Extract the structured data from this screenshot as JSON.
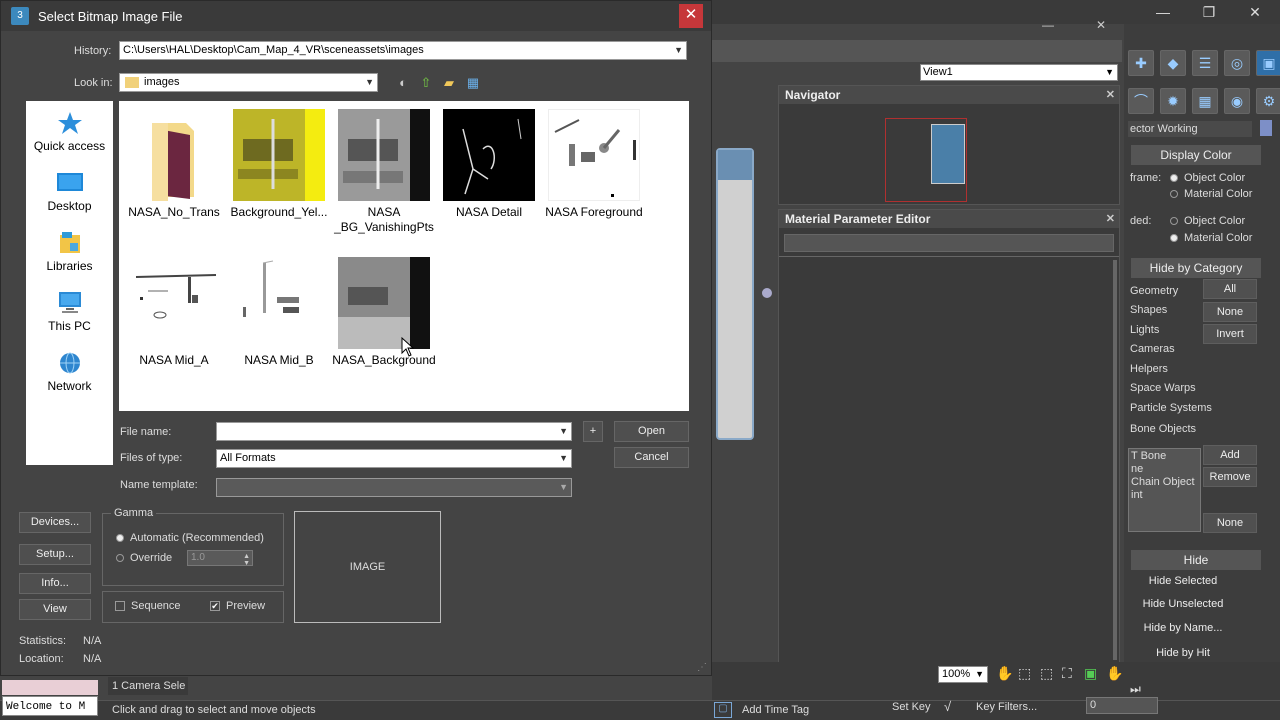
{
  "dialog": {
    "title": "Select Bitmap Image File",
    "close_glyph": "✕",
    "history_label": "History:",
    "history_value": "C:\\Users\\HAL\\Desktop\\Cam_Map_4_VR\\sceneassets\\images",
    "lookin_label": "Look in:",
    "lookin_value": "images",
    "places": [
      {
        "label": "Quick access",
        "icon": "star-icon"
      },
      {
        "label": "Desktop",
        "icon": "desktop-icon"
      },
      {
        "label": "Libraries",
        "icon": "libraries-icon"
      },
      {
        "label": "This PC",
        "icon": "computer-icon"
      },
      {
        "label": "Network",
        "icon": "network-icon"
      }
    ],
    "files": [
      {
        "label": "NASA_No_Trans"
      },
      {
        "label": "Background_Yel..."
      },
      {
        "label": "NASA _BG_VanishingPts"
      },
      {
        "label": "NASA Detail"
      },
      {
        "label": "NASA Foreground"
      },
      {
        "label": "NASA Mid_A"
      },
      {
        "label": "NASA Mid_B"
      },
      {
        "label": "NASA_Background"
      }
    ],
    "filename_label": "File name:",
    "filename_value": "",
    "plus_label": "+",
    "filetype_label": "Files of type:",
    "filetype_value": "All Formats",
    "nametemplate_label": "Name template:",
    "open_label": "Open",
    "cancel_label": "Cancel",
    "devices_label": "Devices...",
    "setup_label": "Setup...",
    "info_label": "Info...",
    "view_label": "View",
    "gamma_title": "Gamma",
    "gamma_auto": "Automatic (Recommended)",
    "gamma_override": "Override",
    "gamma_value": "1.0",
    "sequence_label": "Sequence",
    "preview_label": "Preview",
    "image_label": "IMAGE",
    "statistics_label": "Statistics:",
    "statistics_value": "N/A",
    "location_label": "Location:",
    "location_value": "N/A"
  },
  "max": {
    "view_select": "View1",
    "navigator_title": "Navigator",
    "mpe_title": "Material Parameter Editor",
    "selector": "ector Working",
    "display_color_title": "Display Color",
    "wireframe_label": "frame:",
    "shaded_label": "ded:",
    "object_color": "Object Color",
    "material_color": "Material Color",
    "hide_by_category_title": "Hide by Category",
    "categories": [
      "Geometry",
      "Shapes",
      "Lights",
      "Cameras",
      "Helpers",
      "Space Warps",
      "Particle Systems",
      "Bone Objects"
    ],
    "all_label": "All",
    "none_label": "None",
    "invert_label": "Invert",
    "list_items": [
      "T Bone",
      "ne",
      "Chain Object",
      "int"
    ],
    "add_label": "Add",
    "remove_label": "Remove",
    "none2_label": "None",
    "hide_title": "Hide",
    "hide_selected": "Hide Selected",
    "hide_unselected": "Hide Unselected",
    "hide_by_name": "Hide by Name...",
    "hide_by_hit": "Hide by Hit",
    "zoom_value": "100%",
    "camera_sel": "1 Camera Sele",
    "status_text": "Click and drag to select and move objects",
    "add_time_tag": "Add Time Tag",
    "set_key": "Set Key",
    "key_filters": "Key Filters...",
    "frame_value": "0",
    "welcome": "Welcome to M"
  }
}
